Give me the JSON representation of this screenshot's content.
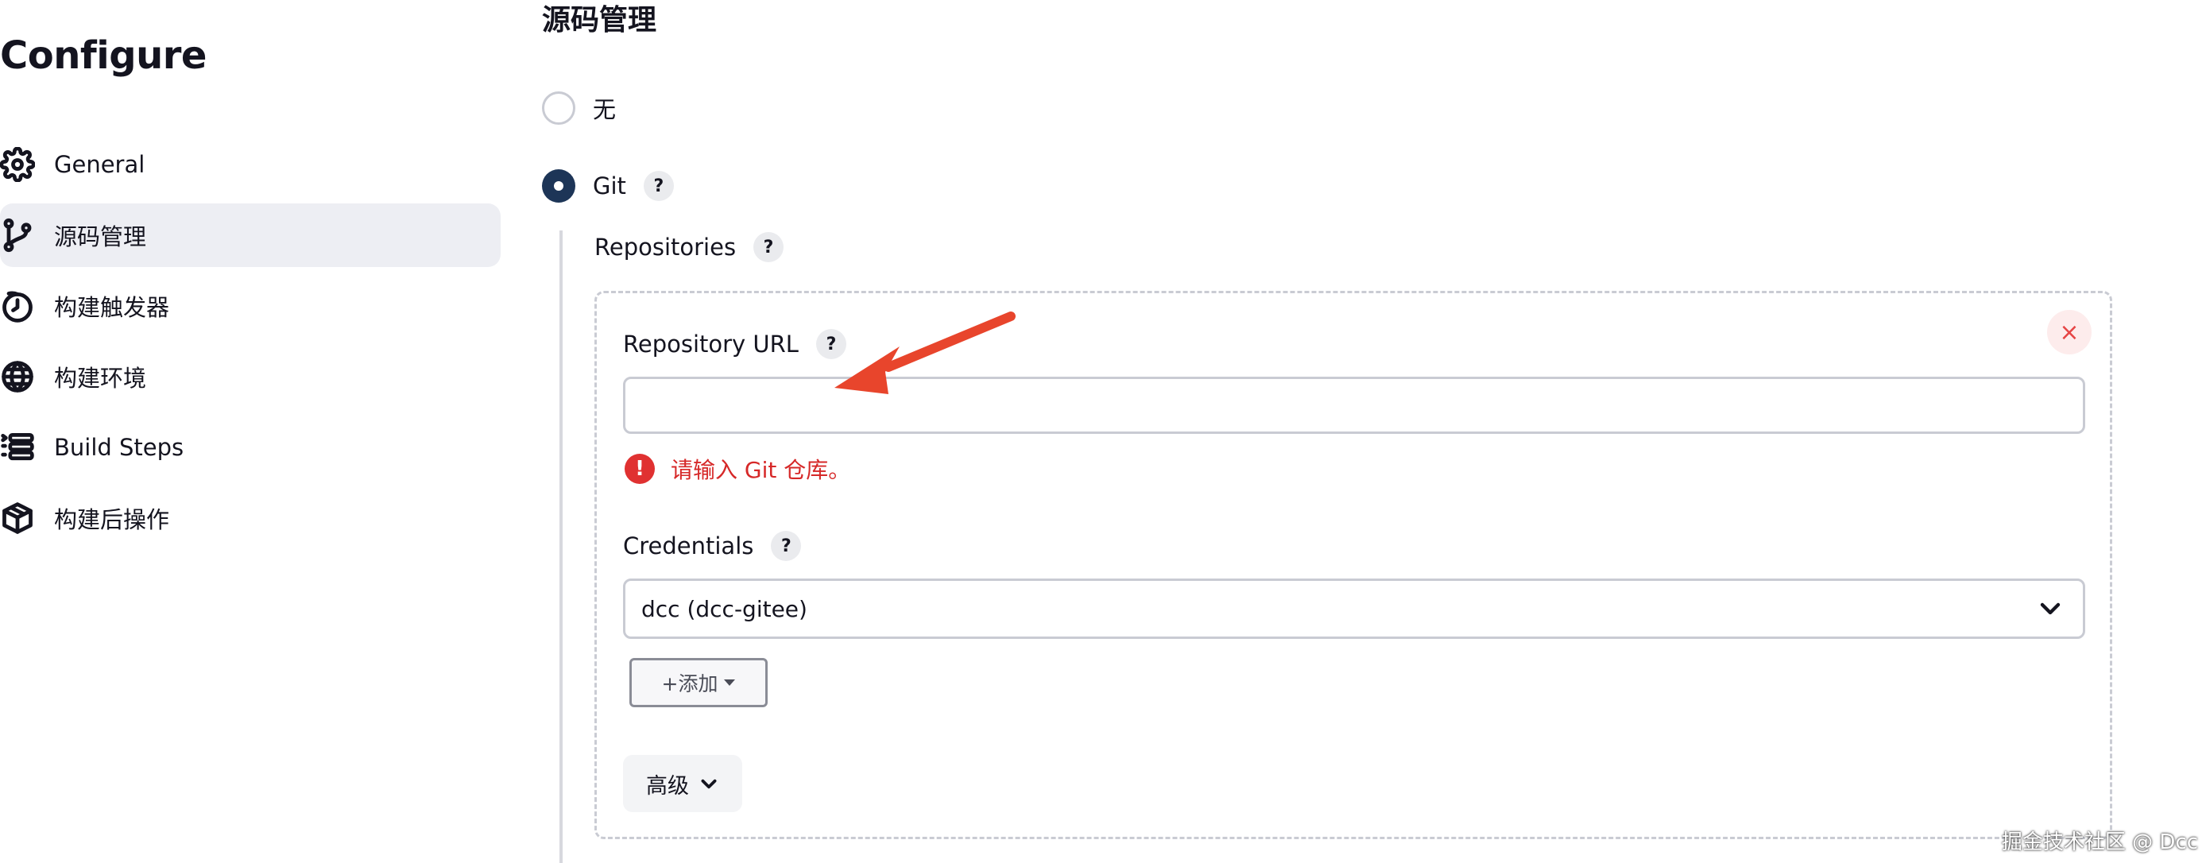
{
  "sidebar": {
    "title": "Configure",
    "items": [
      {
        "label": "General",
        "icon": "gear-icon"
      },
      {
        "label": "源码管理",
        "icon": "git-branch-icon",
        "active": true
      },
      {
        "label": "构建触发器",
        "icon": "clock-icon"
      },
      {
        "label": "构建环境",
        "icon": "globe-icon"
      },
      {
        "label": "Build Steps",
        "icon": "list-icon"
      },
      {
        "label": "构建后操作",
        "icon": "package-icon"
      }
    ]
  },
  "main": {
    "section_title": "源码管理",
    "scm_options": [
      {
        "label": "无",
        "checked": false
      },
      {
        "label": "Git",
        "checked": true
      }
    ],
    "help_label": "?",
    "repositories_label": "Repositories",
    "repository_url_label": "Repository URL",
    "repository_url_value": "",
    "error_icon": "!",
    "error_message": "请输入 Git 仓库。",
    "credentials_label": "Credentials",
    "credentials_selected": "dcc (dcc-gitee)",
    "add_button_label": "+添加",
    "advanced_button_label": "高级",
    "close_symbol": "×"
  },
  "colors": {
    "accent": "#1d3557",
    "error": "#d62828",
    "annotation_arrow": "#e8452c"
  },
  "watermark": "掘金技术社区 @ Dcc"
}
